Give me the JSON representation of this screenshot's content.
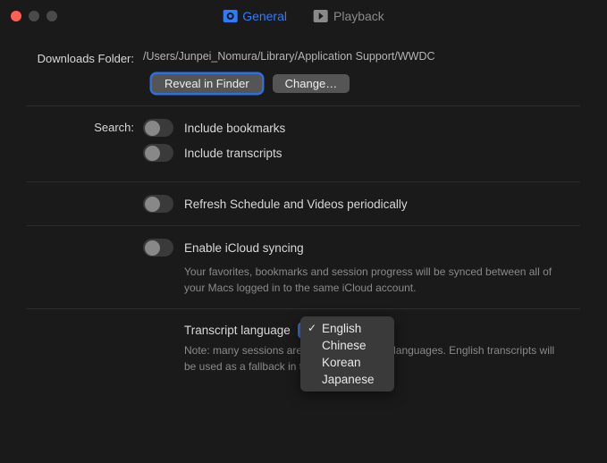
{
  "tabs": {
    "general": "General",
    "playback": "Playback"
  },
  "downloads": {
    "label": "Downloads Folder:",
    "path": "/Users/Junpei_Nomura/Library/Application Support/WWDC",
    "reveal": "Reveal in Finder",
    "change": "Change…"
  },
  "search": {
    "label": "Search:",
    "include_bookmarks": "Include bookmarks",
    "include_transcripts": "Include transcripts"
  },
  "refresh": {
    "label": "Refresh Schedule and Videos periodically"
  },
  "icloud": {
    "label": "Enable iCloud syncing",
    "desc": "Your favorites, bookmarks and session progress will be synced between all of your Macs logged in to the same iCloud account."
  },
  "transcript": {
    "label": "Transcript language",
    "desc": "Note: many sessions are not available in all languages. English transcripts will be used as a fallback in those sessions.",
    "options": [
      "English",
      "Chinese",
      "Korean",
      "Japanese"
    ],
    "selected": "English"
  }
}
